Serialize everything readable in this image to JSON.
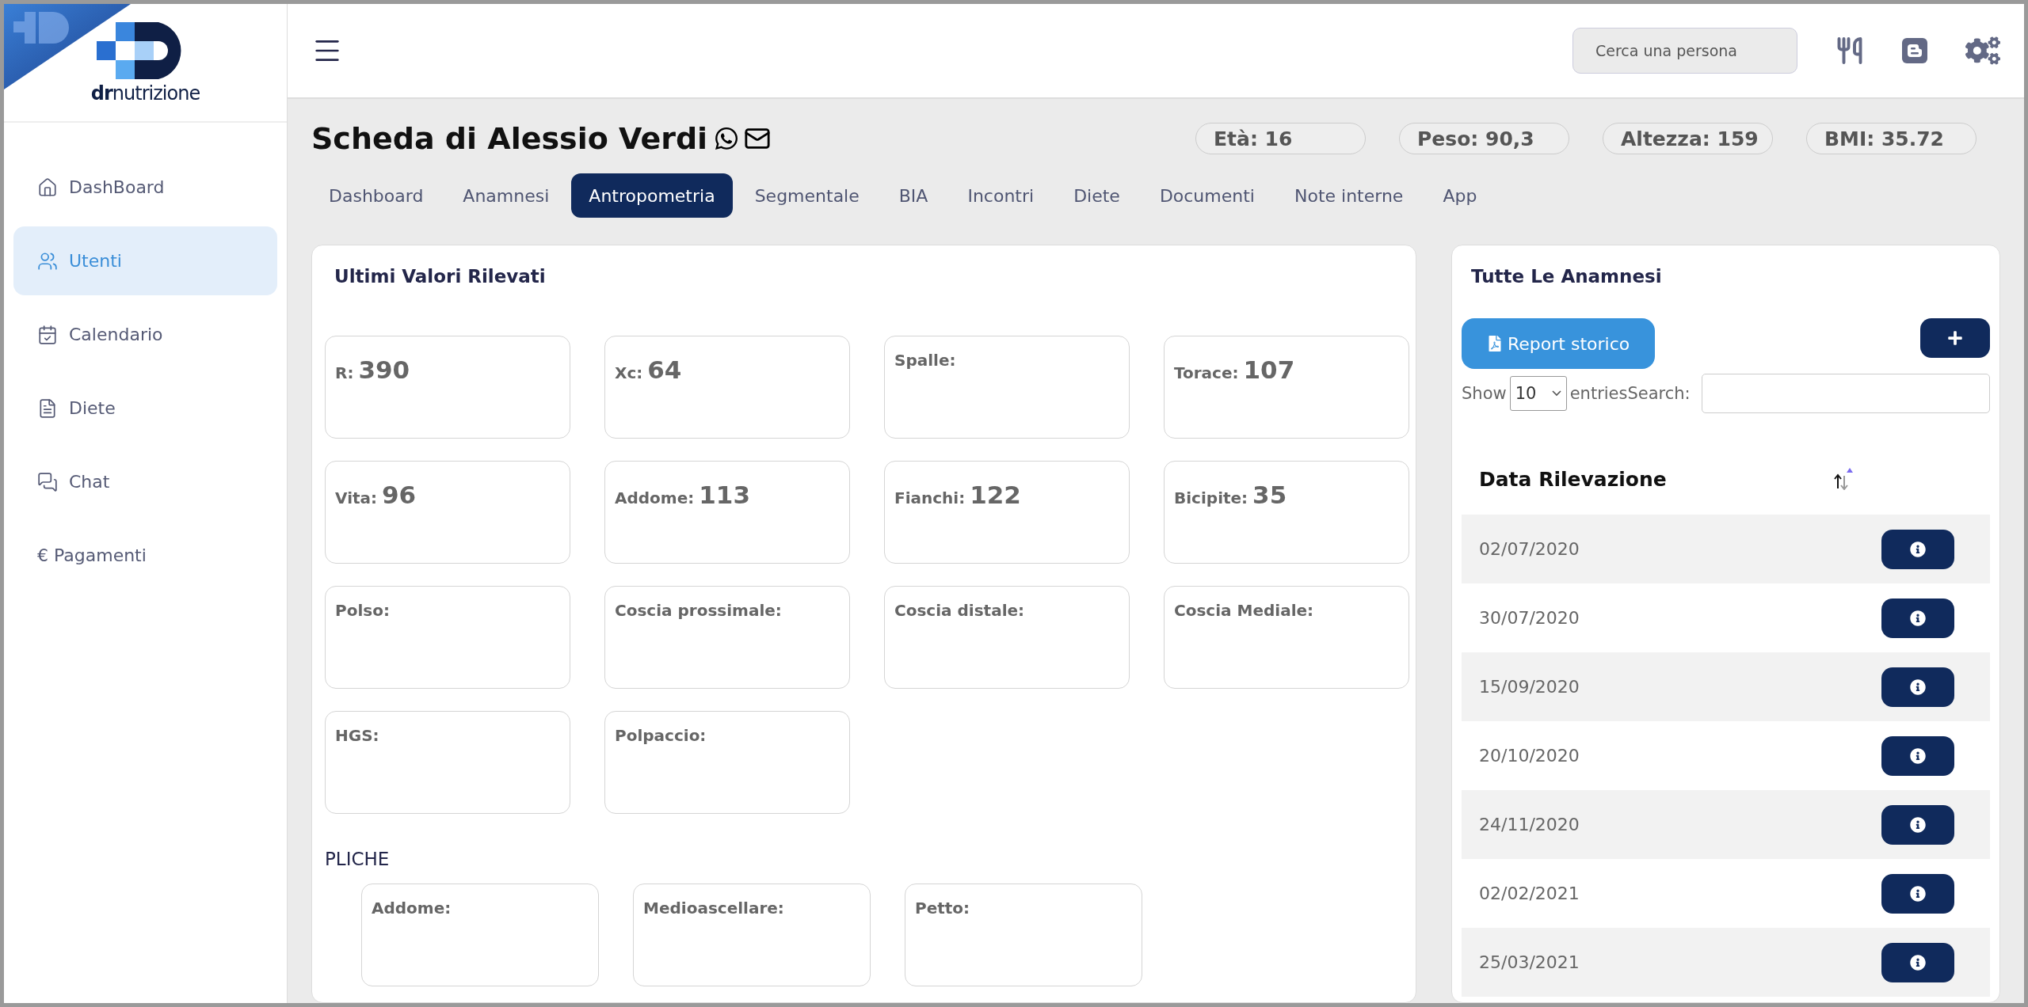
{
  "logo": {
    "text": "**dr**nutrizione"
  },
  "sidebar": {
    "items": [
      {
        "label": "DashBoard",
        "selected": false
      },
      {
        "label": "Utenti",
        "selected": true
      },
      {
        "label": "Calendario",
        "selected": false
      },
      {
        "label": "Diete",
        "selected": false
      },
      {
        "label": "Chat",
        "selected": false
      },
      {
        "label": "€ Pagamenti",
        "selected": false
      }
    ]
  },
  "header": {
    "search_placeholder": "Cerca una persona"
  },
  "profile": {
    "title": "Scheda di Alessio Verdi",
    "stats": [
      "Età: 16",
      "Peso: 90,3",
      "Altezza: 159",
      "BMI: 35.72"
    ]
  },
  "tabs": [
    {
      "label": "Dashboard",
      "selected": false
    },
    {
      "label": "Anamnesi",
      "selected": false
    },
    {
      "label": "Antropometria",
      "selected": true
    },
    {
      "label": "Segmentale",
      "selected": false
    },
    {
      "label": "BIA",
      "selected": false
    },
    {
      "label": "Incontri",
      "selected": false
    },
    {
      "label": "Diete",
      "selected": false
    },
    {
      "label": "Documenti",
      "selected": false
    },
    {
      "label": "Note interne",
      "selected": false
    },
    {
      "label": "App",
      "selected": false
    }
  ],
  "measurements": {
    "title": "Ultimi Valori Rilevati",
    "cards": [
      {
        "label": "R:",
        "value": "390"
      },
      {
        "label": "Xc:",
        "value": "64"
      },
      {
        "label": "Spalle:"
      },
      {
        "label": "Torace:",
        "value": "107"
      },
      {
        "label": "Vita:",
        "value": "96"
      },
      {
        "label": "Addome:",
        "value": "113"
      },
      {
        "label": "Fianchi:",
        "value": "122"
      },
      {
        "label": "Bicipite:",
        "value": "35"
      },
      {
        "label": "Polso:"
      },
      {
        "label": "Coscia prossimale:"
      },
      {
        "label": "Coscia distale:"
      },
      {
        "label": "Coscia Mediale:"
      },
      {
        "label": "HGS:"
      },
      {
        "label": "Polpaccio:"
      }
    ]
  },
  "pliche": {
    "title": "PLICHE",
    "cards": [
      {
        "label": "Addome:"
      },
      {
        "label": "Medioascellare:"
      },
      {
        "label": "Petto:"
      }
    ]
  },
  "history": {
    "title": "Tutte Le Anamnesi",
    "report_button": "Report storico",
    "show_label": "Show",
    "page_size": "10",
    "entries_label": "entries",
    "search_label": "Search:",
    "column": "Data Rilevazione",
    "rows": [
      "02/07/2020",
      "30/07/2020",
      "15/09/2020",
      "20/10/2020",
      "24/11/2020",
      "02/02/2021",
      "25/03/2021"
    ]
  }
}
